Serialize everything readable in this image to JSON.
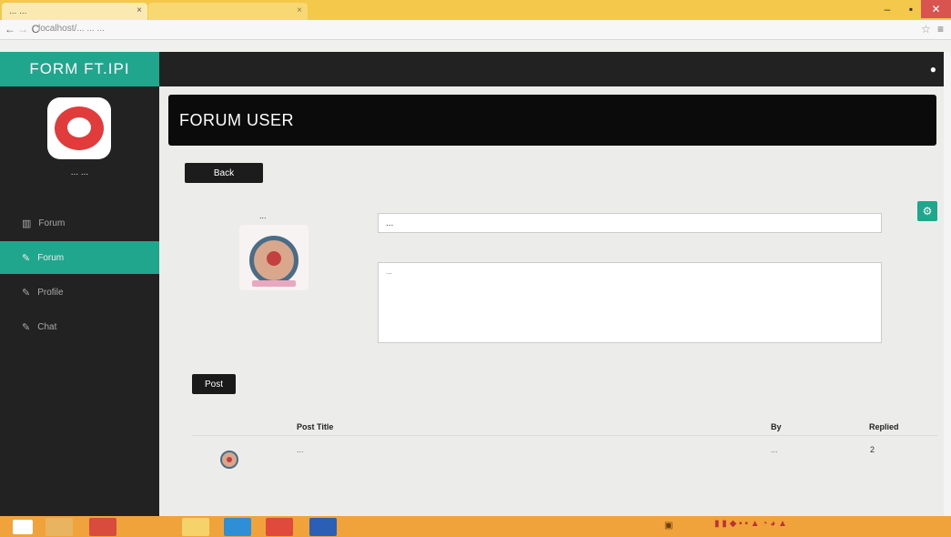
{
  "browser": {
    "tab1_title": "... ...",
    "tab2_title": "",
    "url": "localhost/... ... ...",
    "icons": [
      "back-icon",
      "forward-icon",
      "reload-icon",
      "star-icon",
      "menu-icon"
    ]
  },
  "sidebar": {
    "brand": "FORM FT.IPI",
    "user_name": "... ...",
    "user_sub": "",
    "items": [
      {
        "label": "Forum",
        "icon": "bar-chart-icon"
      },
      {
        "label": "Forum",
        "icon": "edit-icon",
        "active": true
      },
      {
        "label": "Profile",
        "icon": "edit-icon"
      },
      {
        "label": "Chat",
        "icon": "edit-icon"
      }
    ]
  },
  "main": {
    "page_title": "FORUM USER",
    "back_button": "Back",
    "post_author": "...",
    "title_input_value": "...",
    "content_value": "...",
    "post_button": "Post",
    "table": {
      "headers": [
        "Post Title",
        "By",
        "Replied"
      ],
      "rows": [
        {
          "title": "...",
          "by": "...",
          "replied": "2"
        }
      ]
    }
  },
  "colors": {
    "accent": "#1fa68c",
    "sidebar_bg": "#222222",
    "header_bg": "#0b0b0b",
    "taskbar": "#f0a23b"
  }
}
